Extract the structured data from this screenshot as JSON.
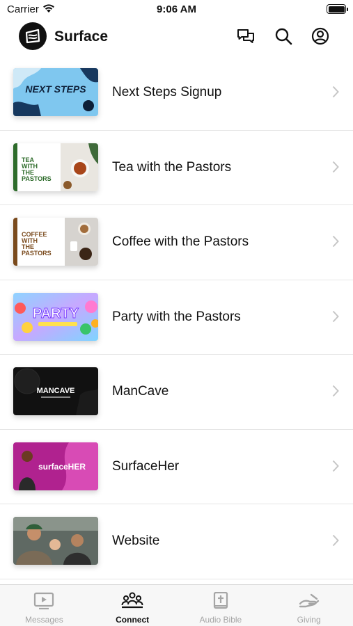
{
  "status_bar": {
    "carrier": "Carrier",
    "time": "9:06 AM"
  },
  "header": {
    "title": "Surface"
  },
  "items": [
    {
      "label": "Next Steps Signup",
      "thumb_text": "NEXT STEPS"
    },
    {
      "label": "Tea with the Pastors",
      "thumb_text": [
        "TEA",
        "WITH",
        "THE",
        "PASTORS"
      ]
    },
    {
      "label": "Coffee with the Pastors",
      "thumb_text": [
        "COFFEE",
        "WITH",
        "THE",
        "PASTORS"
      ]
    },
    {
      "label": "Party with the Pastors",
      "thumb_text": "PARTY"
    },
    {
      "label": "ManCave",
      "thumb_text": "MANCAVE"
    },
    {
      "label": "SurfaceHer",
      "thumb_text": "surfaceHER"
    },
    {
      "label": "Website",
      "thumb_text": ""
    }
  ],
  "tabs": [
    {
      "label": "Messages",
      "icon": "tv-play-icon",
      "active": false
    },
    {
      "label": "Connect",
      "icon": "group-icon",
      "active": true
    },
    {
      "label": "Audio Bible",
      "icon": "bible-icon",
      "active": false
    },
    {
      "label": "Giving",
      "icon": "giving-hand-icon",
      "active": false
    }
  ],
  "colors": {
    "accent": "#111111",
    "inactive": "#a5a5a5"
  }
}
